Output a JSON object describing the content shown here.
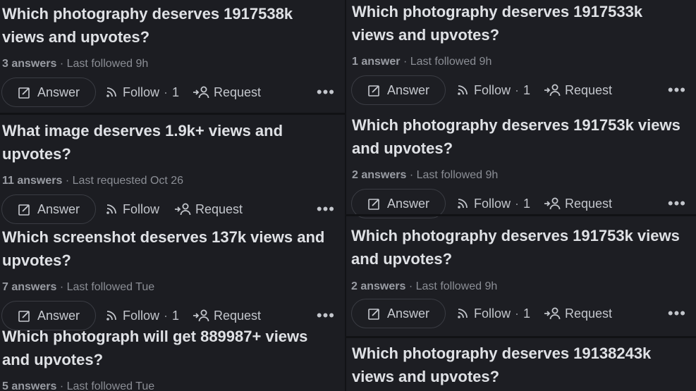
{
  "left": [
    {
      "question": "Which photography deserves 1917538k views and upvotes?",
      "count": "3 answers",
      "activity": "Last followed 9h",
      "follow_label": "Follow",
      "follow_count": "1"
    },
    {
      "question": "What image deserves 1.9k+ views and upvotes?",
      "count": "11 answers",
      "activity": "Last requested Oct 26",
      "follow_label": "Follow",
      "follow_count": ""
    },
    {
      "question": "Which screenshot deserves 137k views and upvotes?",
      "count": "7 answers",
      "activity": "Last followed Tue",
      "follow_label": "Follow",
      "follow_count": "1"
    },
    {
      "question": "Which photograph will get 889987+ views and upvotes?",
      "count": "5 answers",
      "activity": "Last followed Tue"
    }
  ],
  "right": [
    {
      "question": "Which photography deserves 1917533k views and upvotes?",
      "count": "1 answer",
      "activity": "Last followed 9h",
      "follow_label": "Follow",
      "follow_count": "1"
    },
    {
      "question": "Which photography deserves 191753k views and upvotes?",
      "count": "2 answers",
      "activity": "Last followed 9h",
      "follow_label": "Follow",
      "follow_count": "1"
    },
    {
      "question": "Which photography deserves 191753k views and upvotes?",
      "count": "2 answers",
      "activity": "Last followed 9h",
      "follow_label": "Follow",
      "follow_count": "1"
    },
    {
      "question": "Which photography deserves 19138243k views and upvotes?"
    }
  ],
  "labels": {
    "answer": "Answer",
    "request": "Request",
    "more": "•••",
    "dot": "·"
  },
  "colors": {
    "background": "#1c1d22",
    "text": "#dfe1e5",
    "muted": "#8b8e95",
    "border": "#3a3c43"
  }
}
